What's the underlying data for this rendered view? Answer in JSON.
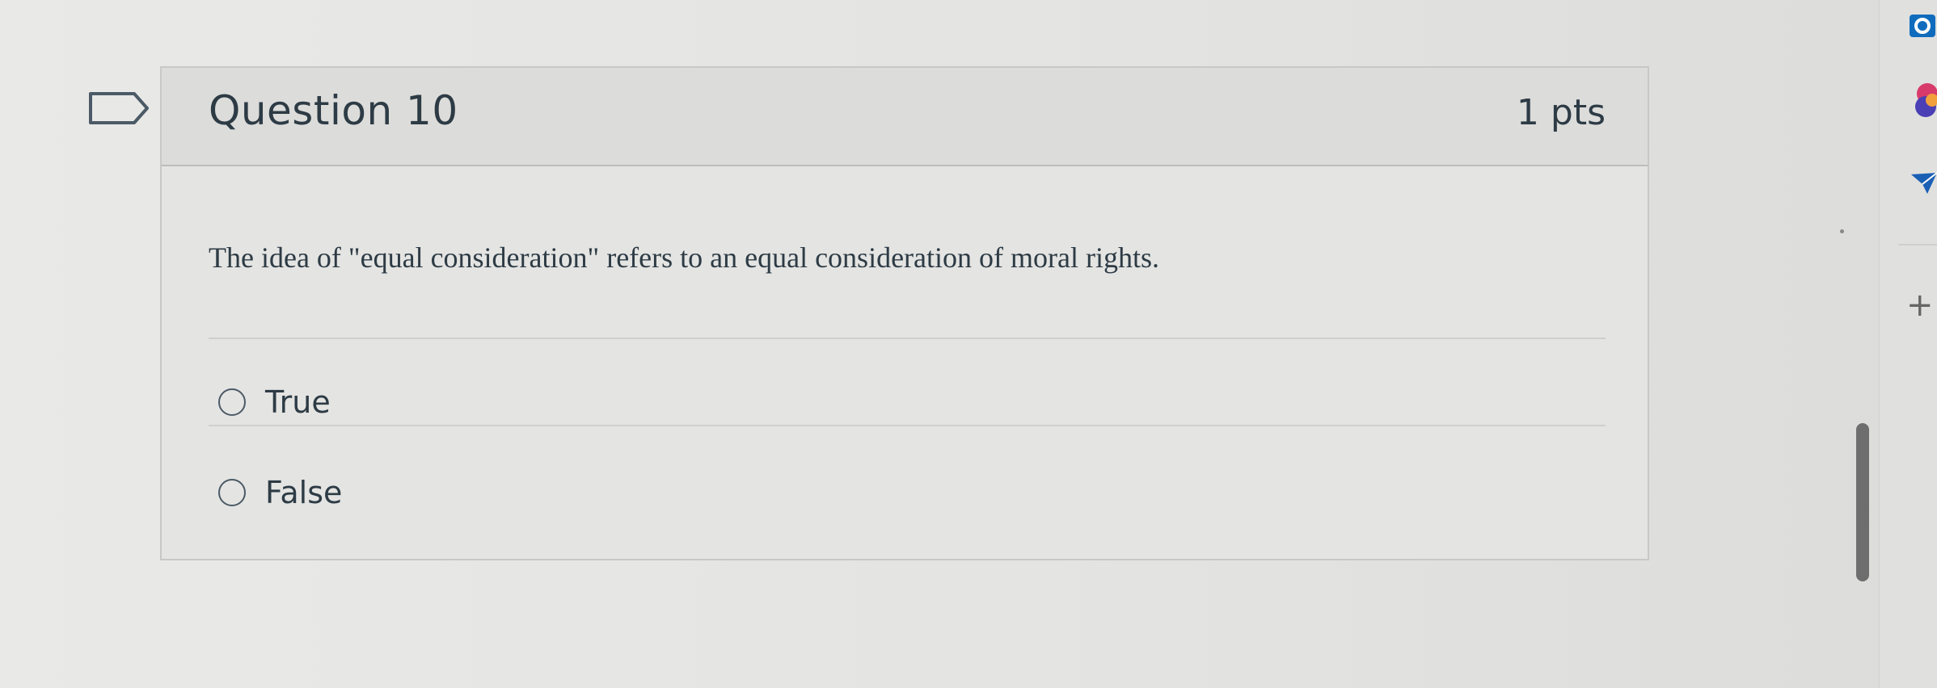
{
  "question": {
    "title": "Question 10",
    "points": "1 pts",
    "text": "The idea of \"equal consideration\" refers to an equal consideration of moral rights.",
    "answers": [
      {
        "label": "True",
        "selected": false
      },
      {
        "label": "False",
        "selected": false
      }
    ]
  },
  "toolbar": {
    "plus_label": "+"
  },
  "icons": {
    "bookmark": "flag-question-icon",
    "outlook": "outlook-icon",
    "colorful": "app-icon",
    "send": "send-icon"
  },
  "colors": {
    "text": "#2d3b45",
    "outlook_blue": "#0f6cbd",
    "accent_pink": "#d83b6b",
    "accent_orange": "#f2a03c"
  }
}
